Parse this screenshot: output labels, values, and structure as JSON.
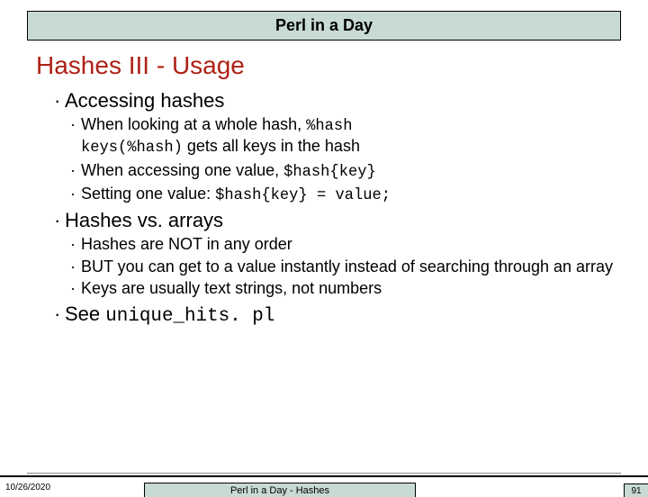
{
  "header": "Perl in a Day",
  "title": "Hashes III - Usage",
  "b1": "Accessing hashes",
  "b1a_pre": "When looking at a whole hash, ",
  "b1a_code": "%hash",
  "b1b_code": "keys(%hash)",
  "b1b_post": " gets all keys in the hash",
  "b1c_pre": "When accessing one value, ",
  "b1c_code": "$hash{key}",
  "b1d_pre": "Setting one value: ",
  "b1d_code": "$hash{key} = value;",
  "b2": "Hashes vs. arrays",
  "b2a": "Hashes are NOT in any order",
  "b2b": "BUT you can get to a value instantly instead of searching through an array",
  "b2c": "Keys are usually text strings, not numbers",
  "b3_pre": "See ",
  "b3_code": "unique_hits. pl",
  "footer_date": "10/26/2020",
  "footer_mid": "Perl in a Day - Hashes",
  "footer_page": "91",
  "chart_data": {
    "type": "table",
    "note": "presentation slide, no chart"
  }
}
